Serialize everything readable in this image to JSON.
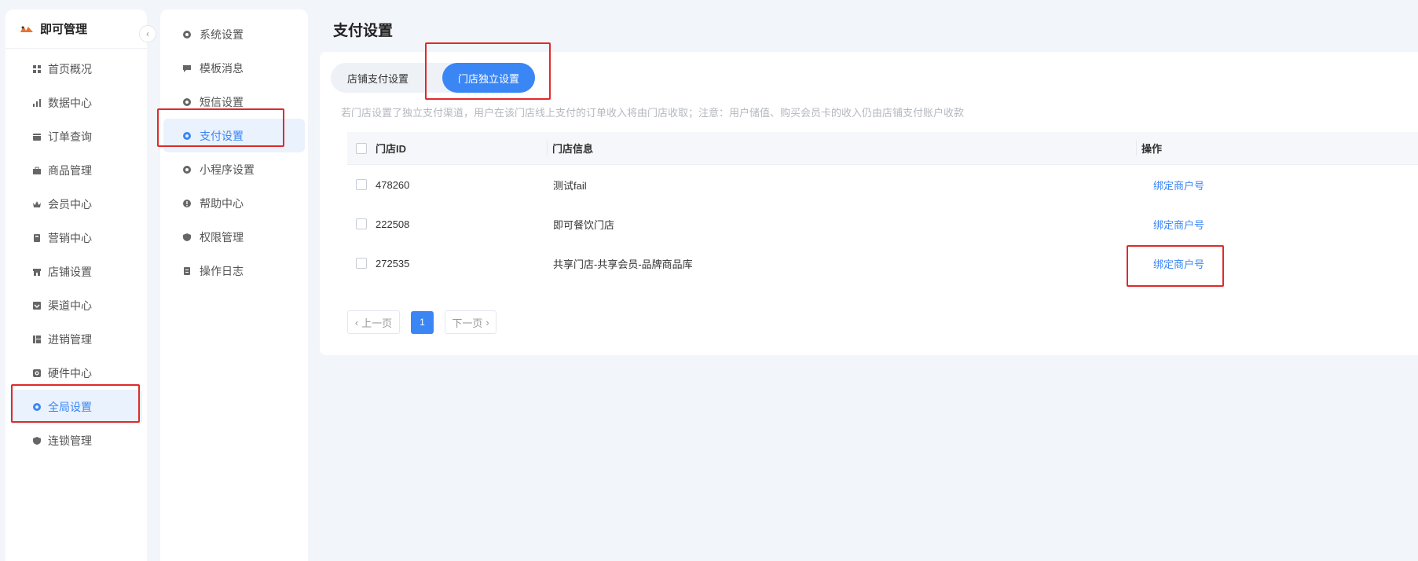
{
  "app": {
    "title": "即可管理",
    "collapse_glyph": "‹"
  },
  "sidebar": {
    "items": [
      {
        "label": "首页概况",
        "icon": "dashboard-icon"
      },
      {
        "label": "数据中心",
        "icon": "bar-chart-icon"
      },
      {
        "label": "订单查询",
        "icon": "order-icon"
      },
      {
        "label": "商品管理",
        "icon": "bag-icon"
      },
      {
        "label": "会员中心",
        "icon": "crown-icon"
      },
      {
        "label": "营销中心",
        "icon": "marketing-icon"
      },
      {
        "label": "店铺设置",
        "icon": "store-icon"
      },
      {
        "label": "渠道中心",
        "icon": "channel-icon"
      },
      {
        "label": "进销管理",
        "icon": "inventory-icon"
      },
      {
        "label": "硬件中心",
        "icon": "hardware-icon"
      },
      {
        "label": "全局设置",
        "icon": "gear-icon",
        "active": true
      },
      {
        "label": "连锁管理",
        "icon": "shield-icon"
      }
    ]
  },
  "subnav": {
    "items": [
      {
        "label": "系统设置",
        "icon": "gear-icon"
      },
      {
        "label": "模板消息",
        "icon": "message-icon"
      },
      {
        "label": "短信设置",
        "icon": "gear-icon"
      },
      {
        "label": "支付设置",
        "icon": "gear-icon",
        "active": true
      },
      {
        "label": "小程序设置",
        "icon": "gear-icon"
      },
      {
        "label": "帮助中心",
        "icon": "info-icon"
      },
      {
        "label": "权限管理",
        "icon": "shield-icon"
      },
      {
        "label": "操作日志",
        "icon": "log-icon"
      }
    ]
  },
  "main": {
    "title": "支付设置",
    "tabs": [
      {
        "label": "店铺支付设置",
        "active": false
      },
      {
        "label": "门店独立设置",
        "active": true
      }
    ],
    "notice": "若门店设置了独立支付渠道，用户在该门店线上支付的订单收入将由门店收取；注意：用户储值、购买会员卡的收入仍由店铺支付账户收款",
    "table": {
      "columns": [
        "门店ID",
        "门店信息",
        "操作"
      ],
      "rows": [
        {
          "id": "478260",
          "info": "测试fail",
          "action": "绑定商户号"
        },
        {
          "id": "222508",
          "info": "即可餐饮门店",
          "action": "绑定商户号"
        },
        {
          "id": "272535",
          "info": "共享门店-共享会员-品牌商品库",
          "action": "绑定商户号"
        }
      ]
    },
    "pagination": {
      "prev": "上一页",
      "current": "1",
      "next": "下一页"
    }
  },
  "colors": {
    "accent": "#3a86f5",
    "highlight": "#e02a2a",
    "background": "#f2f5fa"
  }
}
